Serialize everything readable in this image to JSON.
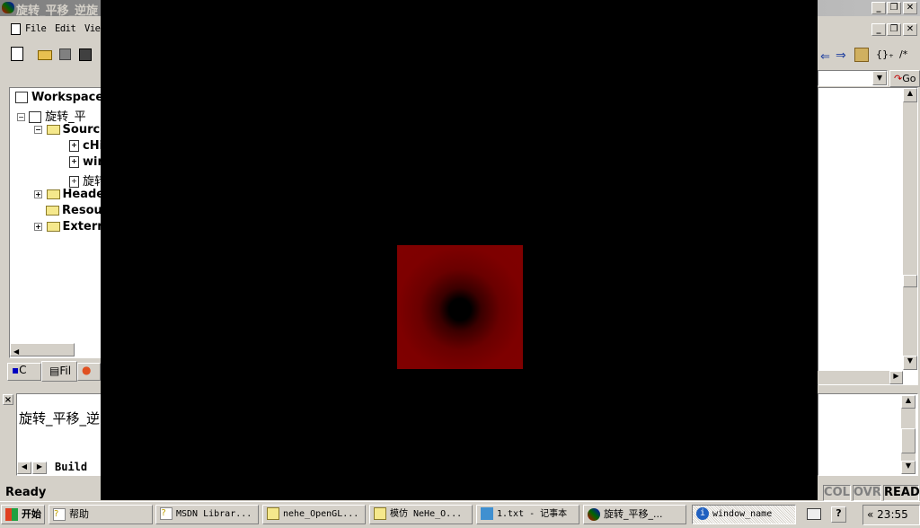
{
  "window": {
    "title": "旋转_平移_逆旋"
  },
  "menu": {
    "file": "File",
    "edit": "Edit",
    "view": "Vie"
  },
  "workspace": {
    "root": "Workspace",
    "project": "旋转_平",
    "items": [
      {
        "label": "Sourc",
        "type": "folder",
        "expanded": true
      },
      {
        "label": "cHi",
        "type": "file"
      },
      {
        "label": "win",
        "type": "file"
      },
      {
        "label": "旋转",
        "type": "file"
      },
      {
        "label": "Heade",
        "type": "folder"
      },
      {
        "label": "Resou",
        "type": "folder"
      },
      {
        "label": "Extern",
        "type": "folder"
      }
    ],
    "tabs": [
      "C",
      "Fil",
      ""
    ]
  },
  "output": {
    "text": "旋转_平移_逆",
    "tab": "Build"
  },
  "status": {
    "text": "Ready",
    "col": "COL",
    "ovr": "OVR",
    "read": "READ"
  },
  "toolbar": {
    "go": "Go"
  },
  "taskbar": {
    "start": "开始",
    "tasks": [
      "帮助",
      "MSDN Librar...",
      "nehe_OpenGL...",
      "模仿 NeHe_O...",
      "1.txt - 记事本",
      "旋转_平移_...",
      "window_name"
    ],
    "clock": "23:55"
  },
  "colors": {
    "square": "#800000",
    "background": "#000000"
  }
}
